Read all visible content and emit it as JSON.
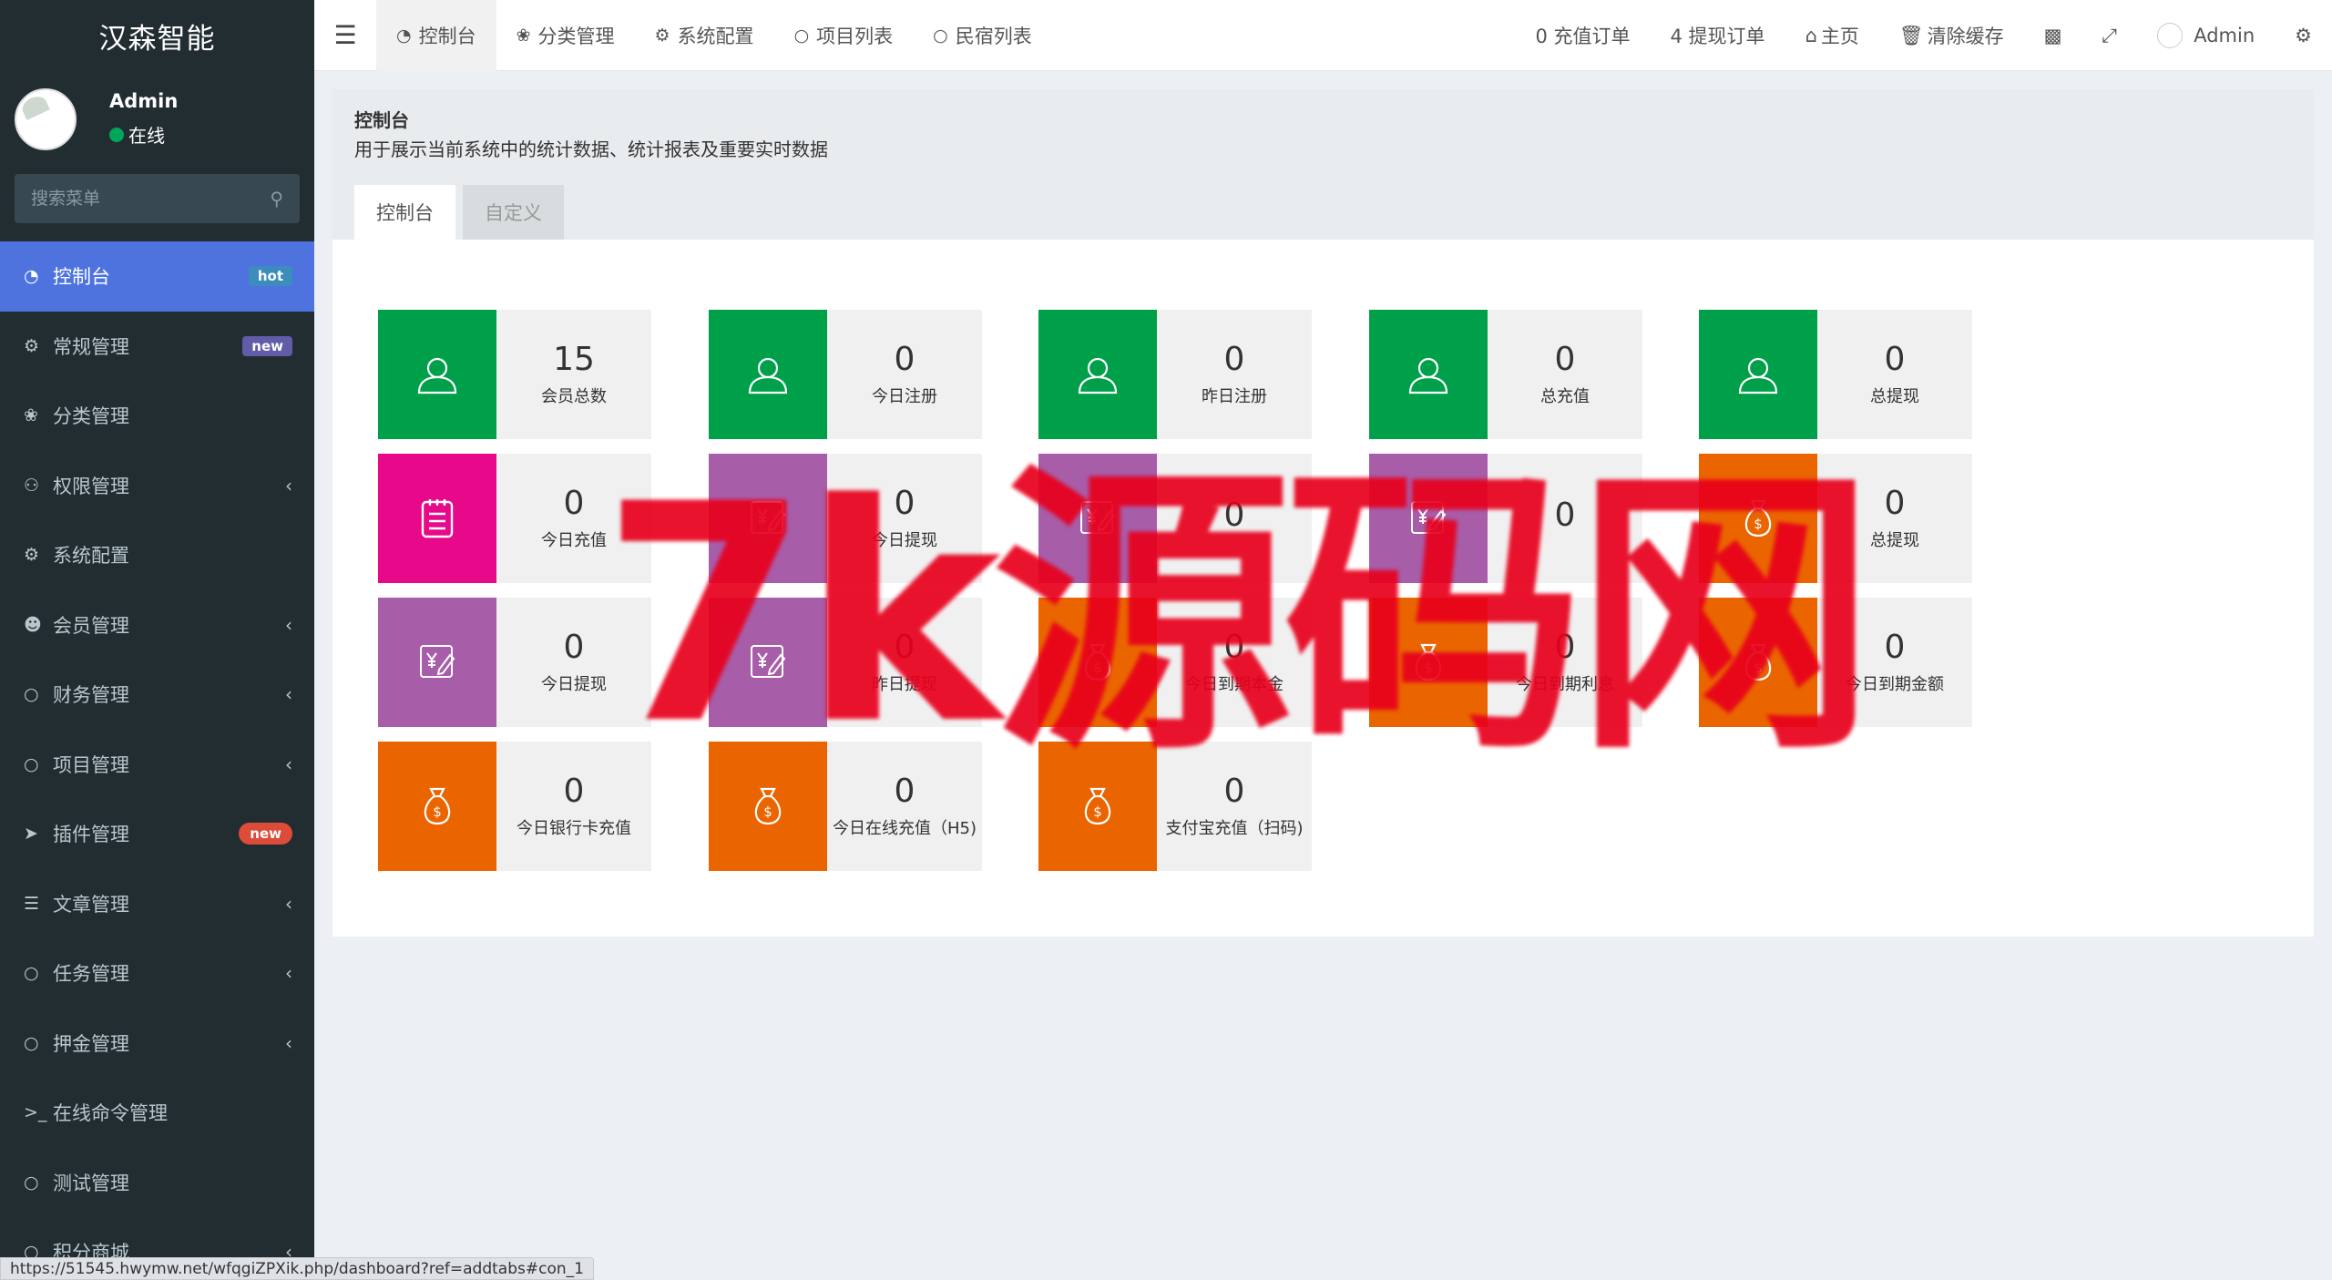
{
  "brand": "汉森智能",
  "user": {
    "name": "Admin",
    "status": "在线"
  },
  "search": {
    "placeholder": "搜索菜单"
  },
  "sidebar": {
    "items": [
      {
        "label": "控制台",
        "badge": "hot"
      },
      {
        "label": "常规管理",
        "badge": "new"
      },
      {
        "label": "分类管理"
      },
      {
        "label": "权限管理"
      },
      {
        "label": "系统配置"
      },
      {
        "label": "会员管理"
      },
      {
        "label": "财务管理"
      },
      {
        "label": "项目管理"
      },
      {
        "label": "插件管理",
        "badge": "new"
      },
      {
        "label": "文章管理"
      },
      {
        "label": "任务管理"
      },
      {
        "label": "押金管理"
      },
      {
        "label": "在线命令管理"
      },
      {
        "label": "测试管理"
      },
      {
        "label": "积分商城"
      }
    ]
  },
  "topnav": {
    "tabs": [
      "控制台",
      "分类管理",
      "系统配置",
      "项目列表",
      "民宿列表"
    ],
    "right": {
      "recharge_orders": "0 充值订单",
      "withdraw_orders": "4 提现订单",
      "home": "主页",
      "clear_cache": "清除缓存",
      "admin": "Admin"
    }
  },
  "header": {
    "title": "控制台",
    "desc": "用于展示当前系统中的统计数据、统计报表及重要实时数据",
    "tabs": [
      "控制台",
      "自定义"
    ]
  },
  "cards": [
    {
      "value": "15",
      "label": "会员总数",
      "color": "#00a04a",
      "icon": "user-icon"
    },
    {
      "value": "0",
      "label": "今日注册",
      "color": "#00a04a",
      "icon": "user-icon"
    },
    {
      "value": "0",
      "label": "昨日注册",
      "color": "#00a04a",
      "icon": "user-icon"
    },
    {
      "value": "0",
      "label": "总充值",
      "color": "#00a04a",
      "icon": "user-icon"
    },
    {
      "value": "0",
      "label": "总提现",
      "color": "#00a04a",
      "icon": "user-icon"
    },
    {
      "value": "0",
      "label": "今日充值",
      "color": "#e7098a",
      "icon": "clipboard-icon"
    },
    {
      "value": "0",
      "label": "今日提现",
      "color": "#a85da9",
      "icon": "yen-edit-icon"
    },
    {
      "value": "0",
      "label": "",
      "color": "#a85da9",
      "icon": "yen-edit-icon"
    },
    {
      "value": "0",
      "label": "",
      "color": "#a85da9",
      "icon": "yen-edit-icon"
    },
    {
      "value": "0",
      "label": "总提现",
      "color": "#ea6500",
      "icon": "money-bag-icon"
    },
    {
      "value": "0",
      "label": "今日提现",
      "color": "#a85da9",
      "icon": "yen-edit-icon"
    },
    {
      "value": "0",
      "label": "昨日提现",
      "color": "#a85da9",
      "icon": "yen-edit-icon"
    },
    {
      "value": "0",
      "label": "今日到期本金",
      "color": "#ea6500",
      "icon": "money-bag-icon"
    },
    {
      "value": "0",
      "label": "今日到期利息",
      "color": "#ea6500",
      "icon": "money-bag-icon"
    },
    {
      "value": "0",
      "label": "今日到期金额",
      "color": "#ea6500",
      "icon": "money-bag-icon"
    },
    {
      "value": "0",
      "label": "今日银行卡充值",
      "color": "#ea6500",
      "icon": "money-bag-icon"
    },
    {
      "value": "0",
      "label": "今日在线充值（H5)",
      "color": "#ea6500",
      "icon": "money-bag-icon"
    },
    {
      "value": "0",
      "label": "支付宝充值（扫码)",
      "color": "#ea6500",
      "icon": "money-bag-icon"
    }
  ],
  "watermark": "7k源码网",
  "status_url": "https://51545.hwymw.net/wfqgiZPXik.php/dashboard?ref=addtabs#con_1"
}
